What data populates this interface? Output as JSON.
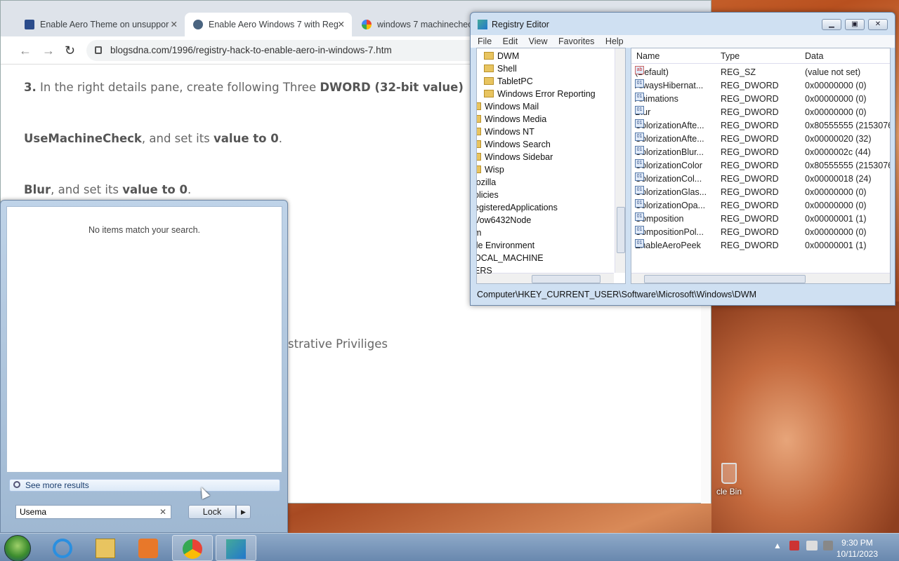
{
  "browser": {
    "tabs": [
      {
        "title": "Enable Aero Theme on unsuppor",
        "active": false,
        "icon": "blog-favicon-icon"
      },
      {
        "title": "Enable Aero Windows 7 with Reg",
        "active": true,
        "icon": "wordpress-icon"
      },
      {
        "title": "windows 7 machinecheck",
        "active": false,
        "icon": "google-icon"
      }
    ],
    "close_glyph": "✕",
    "url": "blogsdna.com/1996/registry-hack-to-enable-aero-in-windows-7.htm",
    "article": {
      "step3_num": "3.",
      "step3_text": " In the right details pane, create following Three ",
      "step3_bold": "DWORD (32-bit value)",
      "line2_bold": "UseMachineCheck",
      "line2_mid": ", and set its ",
      "line2_bold2": "value to 0",
      "line2_end": ".",
      "line3_bold": "Blur",
      "line3_mid": ", and set its ",
      "line3_bold2": "value to 0",
      "line3_end": ".",
      "fragment": "strative Priviliges"
    }
  },
  "registry": {
    "title": "Registry Editor",
    "menu": [
      "File",
      "Edit",
      "View",
      "Favorites",
      "Help"
    ],
    "tree": [
      {
        "label": "DWM",
        "indent": 1,
        "folder": true
      },
      {
        "label": "Shell",
        "indent": 1,
        "folder": true
      },
      {
        "label": "TabletPC",
        "indent": 1,
        "folder": true
      },
      {
        "label": "Windows Error Reporting",
        "indent": 1,
        "folder": true
      },
      {
        "label": "Windows Mail",
        "indent": 0,
        "folder": true
      },
      {
        "label": "Windows Media",
        "indent": 0,
        "folder": true
      },
      {
        "label": "Windows NT",
        "indent": 0,
        "folder": true
      },
      {
        "label": "Windows Search",
        "indent": 0,
        "folder": true
      },
      {
        "label": "Windows Sidebar",
        "indent": 0,
        "folder": true
      },
      {
        "label": "Wisp",
        "indent": 0,
        "folder": true
      },
      {
        "label": "lozilla",
        "indent": -1,
        "folder": false
      },
      {
        "label": "olicies",
        "indent": -1,
        "folder": false
      },
      {
        "label": "egisteredApplications",
        "indent": -1,
        "folder": false
      },
      {
        "label": "Vow6432Node",
        "indent": -1,
        "folder": false
      },
      {
        "label": "m",
        "indent": -1,
        "folder": false
      },
      {
        "label": "ile Environment",
        "indent": -1,
        "folder": false
      },
      {
        "label": "OCAL_MACHINE",
        "indent": -1,
        "folder": false
      },
      {
        "label": "ERS",
        "indent": -1,
        "folder": false
      }
    ],
    "columns": [
      "Name",
      "Type",
      "Data"
    ],
    "values": [
      {
        "name": "(Default)",
        "type": "REG_SZ",
        "data": "(value not set)",
        "kind": "sz"
      },
      {
        "name": "AlwaysHibernat...",
        "type": "REG_DWORD",
        "data": "0x00000000 (0)",
        "kind": "bin"
      },
      {
        "name": "Animations",
        "type": "REG_DWORD",
        "data": "0x00000000 (0)",
        "kind": "bin"
      },
      {
        "name": "Blur",
        "type": "REG_DWORD",
        "data": "0x00000000 (0)",
        "kind": "bin"
      },
      {
        "name": "ColorizationAfte...",
        "type": "REG_DWORD",
        "data": "0x80555555 (215307605",
        "kind": "bin"
      },
      {
        "name": "ColorizationAfte...",
        "type": "REG_DWORD",
        "data": "0x00000020 (32)",
        "kind": "bin"
      },
      {
        "name": "ColorizationBlur...",
        "type": "REG_DWORD",
        "data": "0x0000002c (44)",
        "kind": "bin"
      },
      {
        "name": "ColorizationColor",
        "type": "REG_DWORD",
        "data": "0x80555555 (215307605",
        "kind": "bin"
      },
      {
        "name": "ColorizationCol...",
        "type": "REG_DWORD",
        "data": "0x00000018 (24)",
        "kind": "bin"
      },
      {
        "name": "ColorizationGlas...",
        "type": "REG_DWORD",
        "data": "0x00000000 (0)",
        "kind": "bin"
      },
      {
        "name": "ColorizationOpa...",
        "type": "REG_DWORD",
        "data": "0x00000000 (0)",
        "kind": "bin"
      },
      {
        "name": "Composition",
        "type": "REG_DWORD",
        "data": "0x00000001 (1)",
        "kind": "bin"
      },
      {
        "name": "CompositionPol...",
        "type": "REG_DWORD",
        "data": "0x00000000 (0)",
        "kind": "bin"
      },
      {
        "name": "EnableAeroPeek",
        "type": "REG_DWORD",
        "data": "0x00000001 (1)",
        "kind": "bin"
      }
    ],
    "status": "Computer\\HKEY_CURRENT_USER\\Software\\Microsoft\\Windows\\DWM"
  },
  "start_menu": {
    "no_items": "No items match your search.",
    "see_more": "See more results",
    "search_value": "Usema",
    "clear_glyph": "✕",
    "lock_label": "Lock",
    "arrow_glyph": "▶"
  },
  "desktop": {
    "recycle_label": "cle Bin"
  },
  "taskbar": {
    "apps": [
      "internet-explorer-icon",
      "explorer-folder-icon",
      "media-player-icon",
      "chrome-icon",
      "registry-editor-icon"
    ],
    "time": "9:30 PM",
    "date": "10/11/2023"
  }
}
